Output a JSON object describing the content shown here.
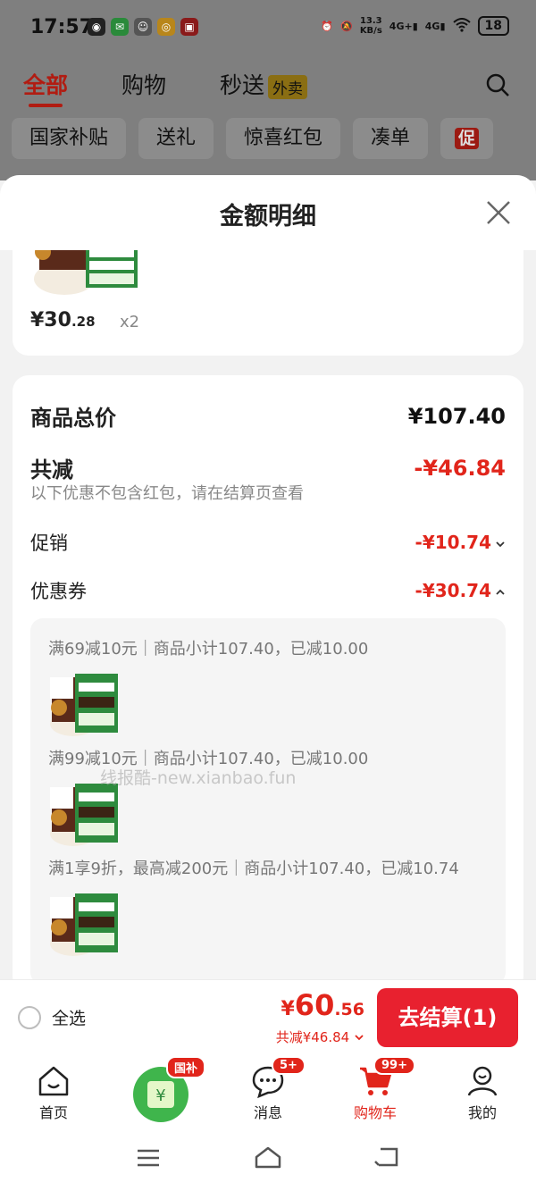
{
  "status_bar": {
    "time": "17:57",
    "net_speed_top": "13.3",
    "net_speed_bottom": "KB/s",
    "sig1": "4G+",
    "sig2": "4G",
    "battery": "18"
  },
  "background_page": {
    "tabs": [
      "全部",
      "购物",
      "秒送"
    ],
    "takeout_tag": "外卖",
    "chips": [
      "国家补贴",
      "送礼",
      "惊喜红包",
      "凑单"
    ],
    "promo_badge": "促"
  },
  "sheet": {
    "title": "金额明细",
    "item": {
      "price_main": "¥30",
      "price_cents": ".28",
      "quantity": "x2"
    },
    "product_total_label": "商品总价",
    "product_total_value": "¥107.40",
    "total_discount_label": "共减",
    "total_discount_value": "-¥46.84",
    "discount_note": "以下优惠不包含红包，请在结算页查看",
    "promotion_label": "促销",
    "promotion_value": "-¥10.74",
    "coupon_label": "优惠券",
    "coupon_value": "-¥30.74",
    "coupons": [
      "满69减10元｜商品小计107.40，已减10.00",
      "满99减10元｜商品小计107.40，已减10.00",
      "满1享9折，最高减200元｜商品小计107.40，已减10.74"
    ]
  },
  "watermark": "线报酷-new.xianbao.fun",
  "checkout": {
    "select_all": "全选",
    "total_yen": "¥",
    "total_main": "60",
    "total_cents": ".56",
    "total_discount": "共减¥46.84",
    "button": "去结算(1)"
  },
  "bottom_nav": {
    "home": "首页",
    "subsidy_badge": "国补",
    "messages": "消息",
    "messages_badge": "5+",
    "cart": "购物车",
    "cart_badge": "99+",
    "mine": "我的"
  },
  "colors": {
    "accent_red": "#e1251b",
    "checkout_button": "#e8212f",
    "coupon_green": "#3fb54c"
  }
}
